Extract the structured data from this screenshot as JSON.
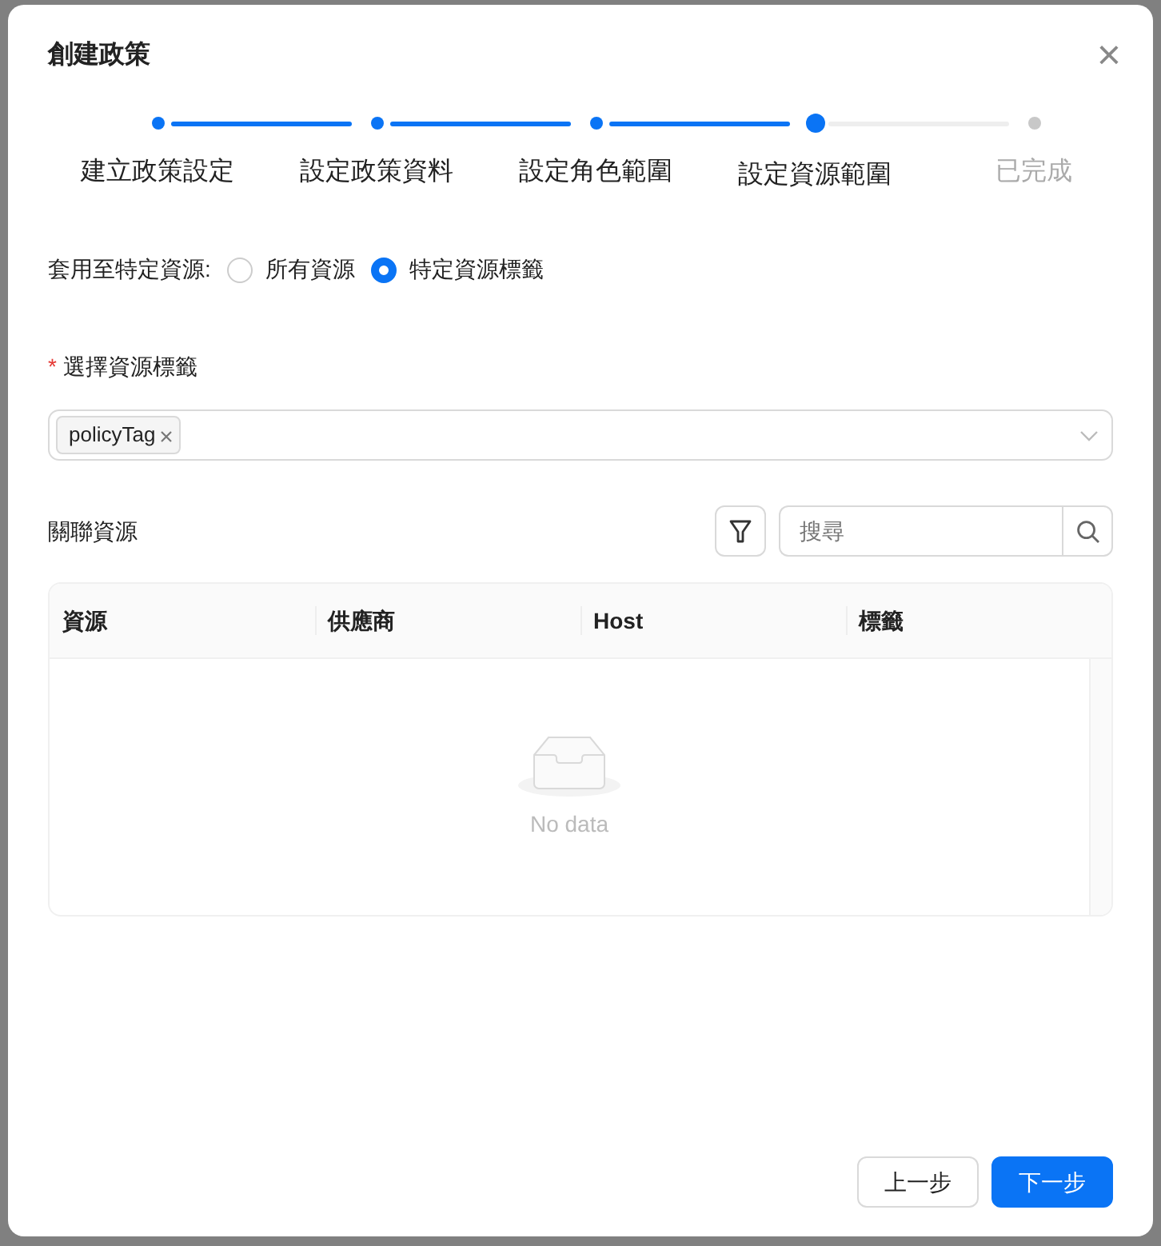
{
  "dialog": {
    "title": "創建政策",
    "close_icon": "×"
  },
  "steps": [
    {
      "label": "建立政策設定",
      "done": true,
      "selected": false
    },
    {
      "label": "設定政策資料",
      "done": true,
      "selected": false
    },
    {
      "label": "設定角色範圍",
      "done": true,
      "selected": false
    },
    {
      "label": "設定資源範圍",
      "done": false,
      "selected": true
    },
    {
      "label": "已完成",
      "done": false,
      "selected": false
    }
  ],
  "apply_to": {
    "label": "套用至特定資源:",
    "options": [
      {
        "label": "所有資源",
        "selected": false
      },
      {
        "label": "特定資源標籤",
        "selected": true
      }
    ]
  },
  "tag_select": {
    "label": "選擇資源標籤",
    "required_mark": "*",
    "tags": [
      {
        "label": "policyTag"
      }
    ]
  },
  "related": {
    "label": "關聯資源",
    "search": {
      "placeholder": "搜尋"
    }
  },
  "table": {
    "columns": [
      "資源",
      "供應商",
      "Host",
      "標籤"
    ],
    "empty_text": "No data"
  },
  "buttons": [
    {
      "label": "上一步",
      "kind": "secondary"
    },
    {
      "label": "下一步",
      "kind": "primary"
    }
  ]
}
